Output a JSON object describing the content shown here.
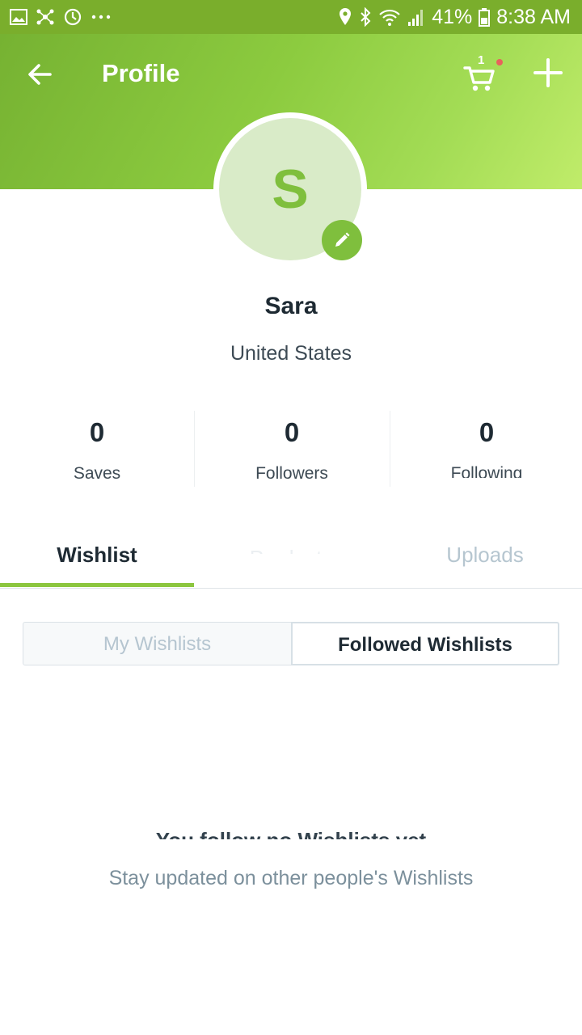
{
  "status_bar": {
    "battery": "41%",
    "time": "8:38 AM",
    "icons": [
      "gallery-icon",
      "network-icon",
      "sync-icon",
      "more-icon",
      "location-icon",
      "bluetooth-icon",
      "wifi-icon",
      "signal-icon",
      "battery-icon"
    ]
  },
  "header": {
    "title": "Profile",
    "cart_count": "1",
    "icons": [
      "back-arrow-icon",
      "cart-icon",
      "plus-icon"
    ]
  },
  "profile": {
    "initial": "S",
    "name": "Sara",
    "location": "United States"
  },
  "stats": [
    {
      "value": "0",
      "label": "Saves"
    },
    {
      "value": "0",
      "label": "Followers"
    },
    {
      "value": "0",
      "label": "Following"
    }
  ],
  "tabs": [
    {
      "label": "Wishlist"
    },
    {
      "label": "Products"
    },
    {
      "label": "Uploads"
    }
  ],
  "segmented": {
    "left": "My Wishlists",
    "right": "Followed Wishlists"
  },
  "empty_state": {
    "title": "You follow no Wishlists yet",
    "subtitle": "Stay updated on other people's Wishlists"
  },
  "colors": {
    "brand_green": "#8cc63f",
    "status_bar": "#7aae2c",
    "notification_dot": "#e8625c"
  }
}
